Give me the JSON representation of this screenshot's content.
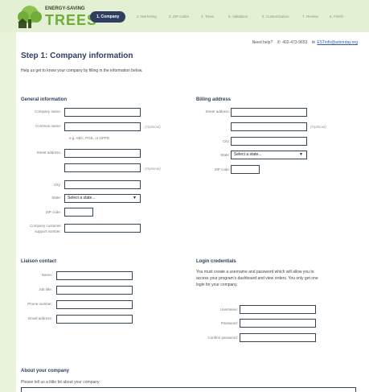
{
  "logo": {
    "line1": "ENERGY-SAVING",
    "line2": "TREES"
  },
  "steps": [
    {
      "label": "1. Company",
      "active": true
    },
    {
      "label": "2. Marketing",
      "active": false
    },
    {
      "label": "3. ZIP codes",
      "active": false
    },
    {
      "label": "4. Trees",
      "active": false
    },
    {
      "label": "5. Validation",
      "active": false
    },
    {
      "label": "6. Customization",
      "active": false
    },
    {
      "label": "7. Review",
      "active": false
    },
    {
      "label": "8. Finish",
      "active": false
    }
  ],
  "help": {
    "label": "Need help?",
    "phone": "402-473-9653",
    "email": "ESTinfo@arborday.org"
  },
  "page": {
    "title": "Step 1: Company information",
    "subtitle": "Help us get to know your company by filling in the information below."
  },
  "general": {
    "title": "General information",
    "company_name": "Company name:",
    "common_name": "Common name:",
    "optional": "(Optional)",
    "common_hint": "e.g. ABC, PGE, or OPPD",
    "street": "Street address:",
    "city": "City:",
    "state": "State:",
    "state_value": "Select a state...",
    "zip": "ZIP code:",
    "support_line1": "Company customer",
    "support_line2": "support number:"
  },
  "billing": {
    "title": "Billing address",
    "street": "Street address:",
    "optional": "(Optional)",
    "city": "City:",
    "state": "State:",
    "state_value": "Select a state...",
    "zip": "ZIP code:"
  },
  "liaison": {
    "title": "Liaison contact",
    "name": "Name:",
    "job": "Job title:",
    "phone": "Phone number:",
    "email": "Email address:"
  },
  "login": {
    "title": "Login credentials",
    "description": "You must create a username and password which will allow you to access your program's dashboard and view orders. You only get one login for your company.",
    "username": "Username:",
    "password": "Password:",
    "confirm": "Confirm password:"
  },
  "about": {
    "title": "About your company",
    "prompt": "Please tell us a little bit about your company:"
  }
}
